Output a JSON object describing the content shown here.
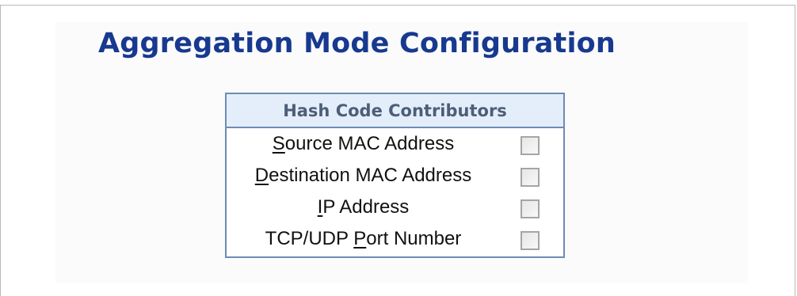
{
  "page": {
    "title": "Aggregation Mode Configuration"
  },
  "table": {
    "header": "Hash Code Contributors",
    "rows": [
      {
        "label_underlined": "S",
        "label_rest": "ource MAC Address",
        "label_prefix": "",
        "checked": false
      },
      {
        "label_underlined": "D",
        "label_rest": "estination MAC Address",
        "label_prefix": "",
        "checked": false
      },
      {
        "label_underlined": "I",
        "label_rest": "P Address",
        "label_prefix": "",
        "checked": false
      },
      {
        "label_prefix": "TCP/UDP ",
        "label_underlined": "P",
        "label_rest": "ort Number",
        "checked": false
      }
    ]
  },
  "colors": {
    "title": "#17398f",
    "table_border": "#6d8bb5",
    "header_bg": "#e4eefa",
    "header_text": "#4c5e78"
  }
}
